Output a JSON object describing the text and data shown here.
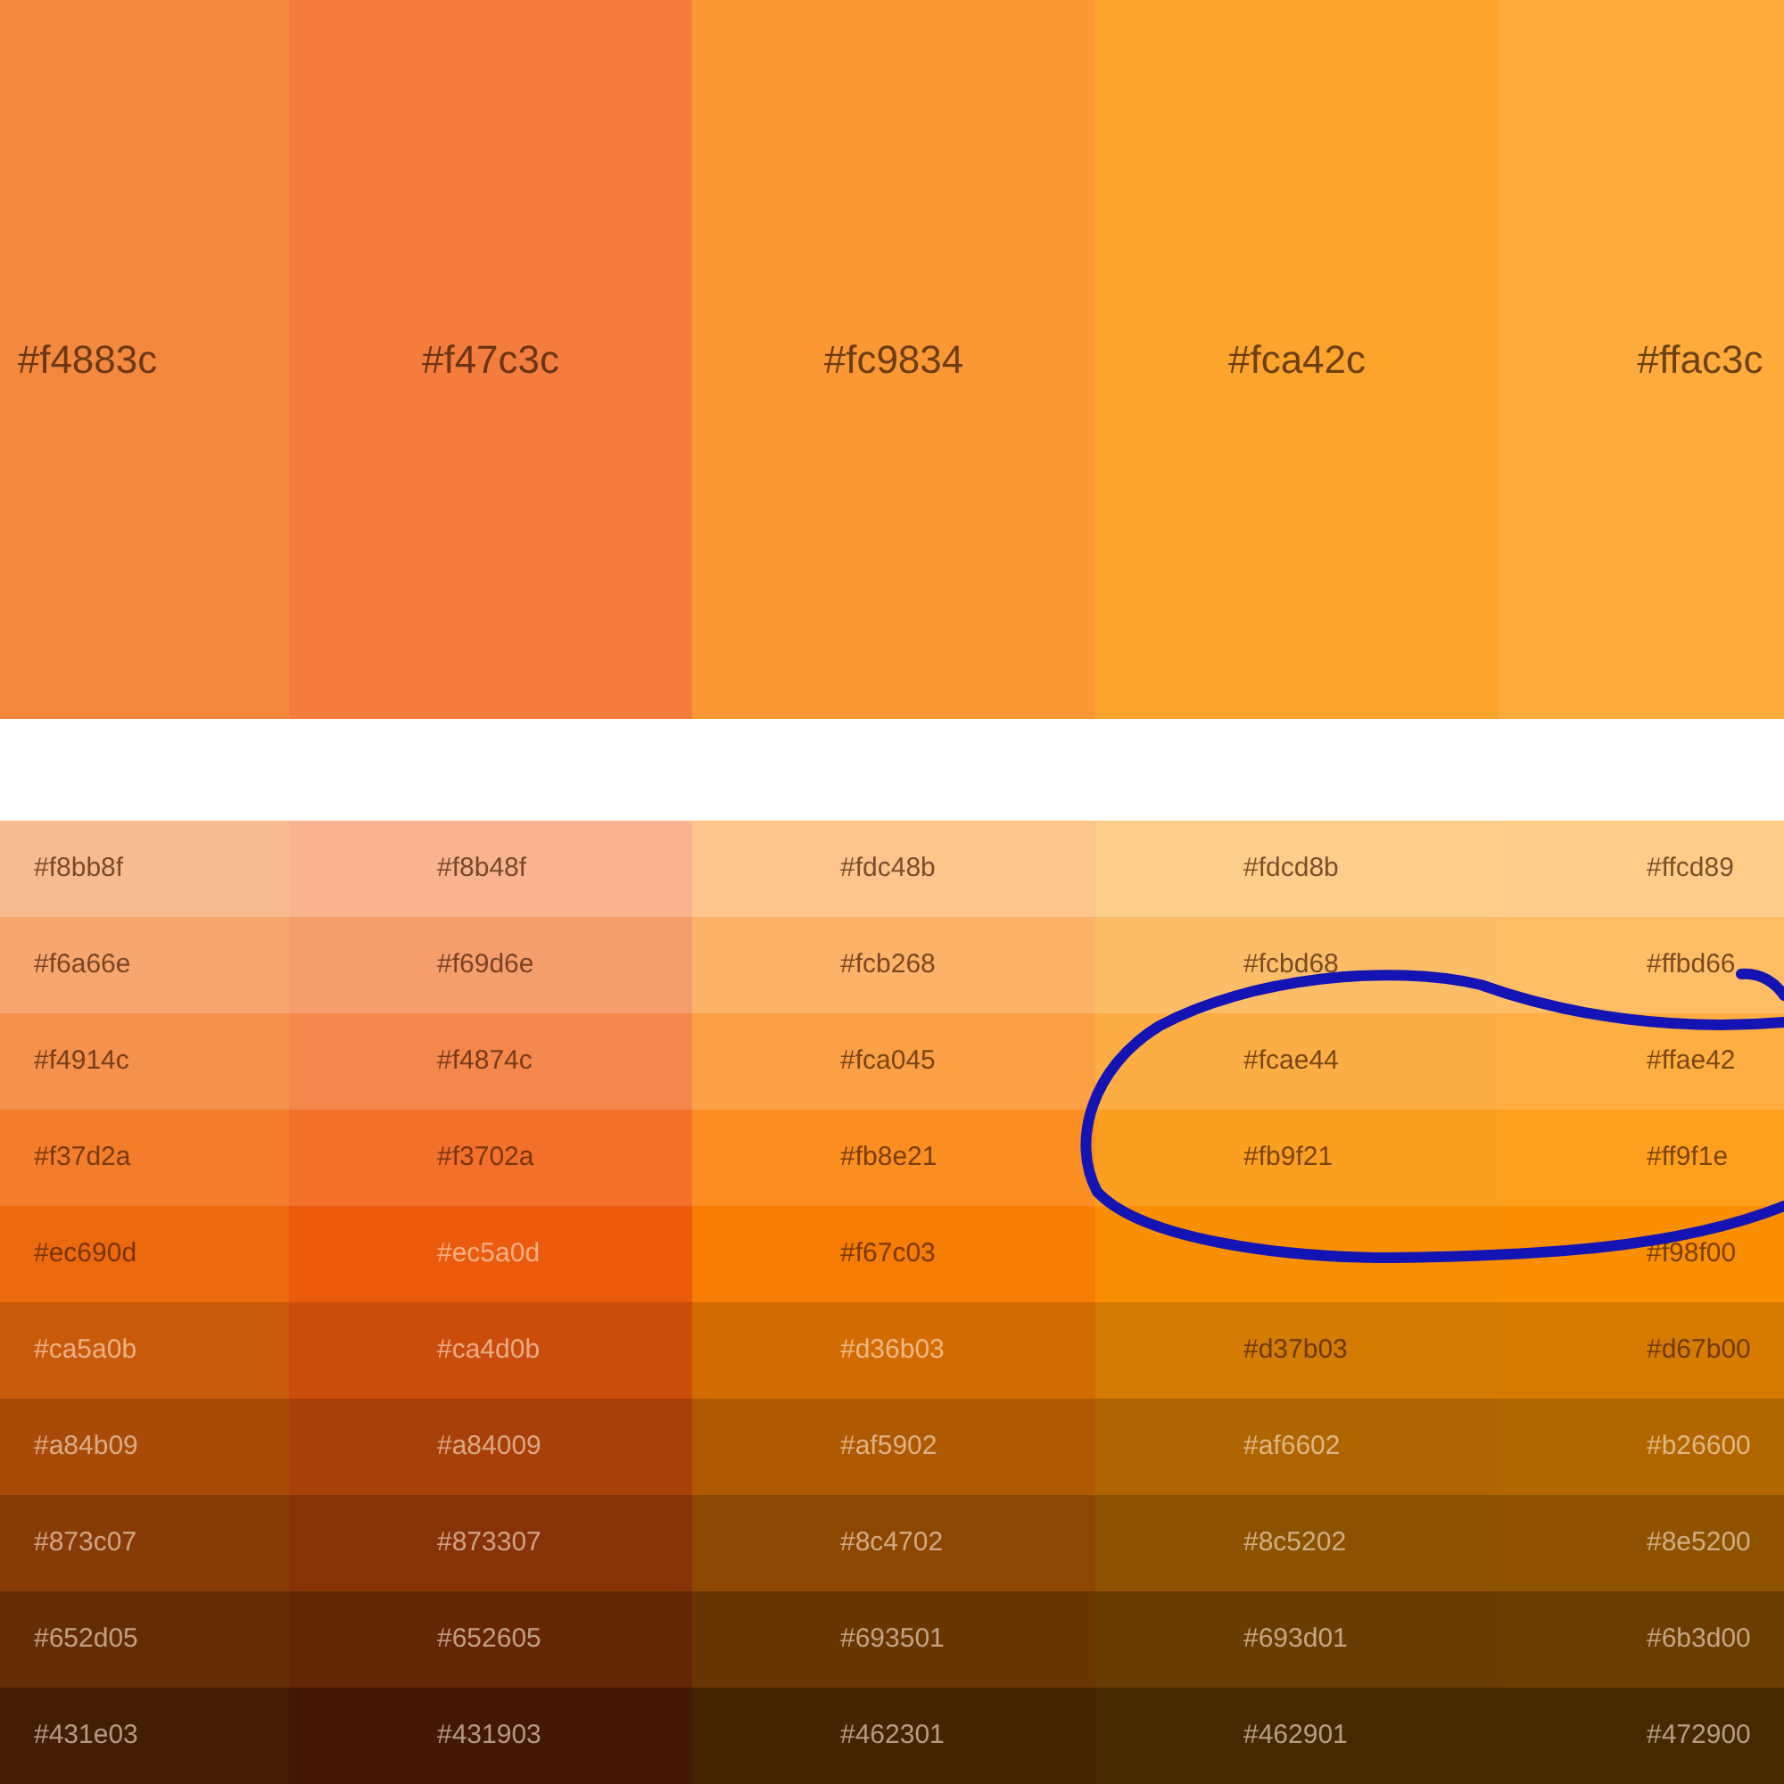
{
  "header_swatches": [
    {
      "label": "#f4883c",
      "color": "#f4883c"
    },
    {
      "label": "#f47c3c",
      "color": "#f47c3c"
    },
    {
      "label": "#fc9834",
      "color": "#fc9834"
    },
    {
      "label": "#fca42c",
      "color": "#fca42c"
    },
    {
      "label": "#ffac3c",
      "color": "#ffac3c"
    }
  ],
  "shade_rows": [
    [
      {
        "label": "#f8bb8f",
        "color": "#f8bb8f"
      },
      {
        "label": "#f8b48f",
        "color": "#f8b48f"
      },
      {
        "label": "#fdc48b",
        "color": "#fdc48b"
      },
      {
        "label": "#fdcd8b",
        "color": "#fdcd8b"
      },
      {
        "label": "#ffcd89",
        "color": "#ffcd89"
      }
    ],
    [
      {
        "label": "#f6a66e",
        "color": "#f6a66e"
      },
      {
        "label": "#f69d6e",
        "color": "#f69d6e"
      },
      {
        "label": "#fcb268",
        "color": "#fcb268"
      },
      {
        "label": "#fcbd68",
        "color": "#fcbd68"
      },
      {
        "label": "#ffbd66",
        "color": "#ffbd66"
      }
    ],
    [
      {
        "label": "#f4914c",
        "color": "#f4914c"
      },
      {
        "label": "#f4874c",
        "color": "#f4874c"
      },
      {
        "label": "#fca045",
        "color": "#fca045"
      },
      {
        "label": "#fcae44",
        "color": "#fcae44"
      },
      {
        "label": "#ffae42",
        "color": "#ffae42"
      }
    ],
    [
      {
        "label": "#f37d2a",
        "color": "#f37d2a"
      },
      {
        "label": "#f3702a",
        "color": "#f3702a"
      },
      {
        "label": "#fb8e21",
        "color": "#fb8e21"
      },
      {
        "label": "#fb9f21",
        "color": "#fb9f21"
      },
      {
        "label": "#ff9f1e",
        "color": "#ff9f1e"
      }
    ],
    [
      {
        "label": "#ec690d",
        "color": "#ec690d"
      },
      {
        "label": "#ec5a0d",
        "color": "#ec5a0d"
      },
      {
        "label": "#f67c03",
        "color": "#f67c03"
      },
      {
        "color": "#f88f03"
      },
      {
        "label": "#f98f00",
        "color": "#f98f00"
      }
    ],
    [
      {
        "label": "#ca5a0b",
        "color": "#ca5a0b"
      },
      {
        "label": "#ca4d0b",
        "color": "#ca4d0b"
      },
      {
        "label": "#d36b03",
        "color": "#d36b03"
      },
      {
        "label": "#d37b03",
        "color": "#d37b03"
      },
      {
        "label": "#d67b00",
        "color": "#d67b00"
      }
    ],
    [
      {
        "label": "#a84b09",
        "color": "#a84b09"
      },
      {
        "label": "#a84009",
        "color": "#a84009"
      },
      {
        "label": "#af5902",
        "color": "#af5902"
      },
      {
        "label": "#af6602",
        "color": "#af6602"
      },
      {
        "label": "#b26600",
        "color": "#b26600"
      }
    ],
    [
      {
        "label": "#873c07",
        "color": "#873c07"
      },
      {
        "label": "#873307",
        "color": "#873307"
      },
      {
        "label": "#8c4702",
        "color": "#8c4702"
      },
      {
        "label": "#8c5202",
        "color": "#8c5202"
      },
      {
        "label": "#8e5200",
        "color": "#8e5200"
      }
    ],
    [
      {
        "label": "#652d05",
        "color": "#652d05"
      },
      {
        "label": "#652605",
        "color": "#652605"
      },
      {
        "label": "#693501",
        "color": "#693501"
      },
      {
        "label": "#693d01",
        "color": "#693d01"
      },
      {
        "label": "#6b3d00",
        "color": "#6b3d00"
      }
    ],
    [
      {
        "label": "#431e03",
        "color": "#431e03"
      },
      {
        "label": "#431903",
        "color": "#431903"
      },
      {
        "label": "#462301",
        "color": "#462301"
      },
      {
        "label": "#462901",
        "color": "#462901"
      },
      {
        "label": "#472900",
        "color": "#472900"
      }
    ]
  ],
  "annotation": {
    "kind": "loop"
  }
}
